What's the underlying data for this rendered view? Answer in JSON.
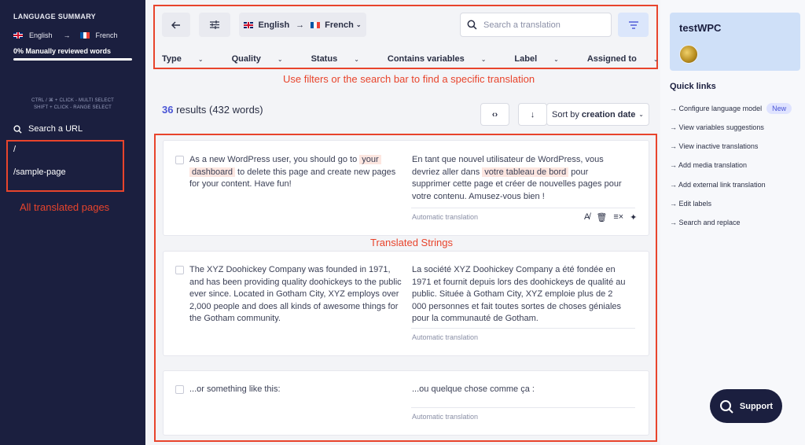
{
  "sidebar": {
    "summary_title": "LANGUAGE SUMMARY",
    "source_lang": "English",
    "target_lang": "French",
    "reviewed_text": "0% Manually reviewed words",
    "reviewed_percent": 0,
    "hint_line1": "CTRL / ⌘ + CLICK - MULTI SELECT",
    "hint_line2": "SHIFT + CLICK - RANGE SELECT",
    "search_url": "Search a URL",
    "pages": [
      "/",
      "/sample-page"
    ],
    "annotation": "All translated pages"
  },
  "toolbar": {
    "source_lang": "English",
    "target_lang": "French",
    "search_placeholder": "Search a translation",
    "filters": [
      "Type",
      "Quality",
      "Status",
      "Contains variables",
      "Label",
      "Assigned to"
    ],
    "annotation": "Use filters or the search bar to find a specific translation"
  },
  "results": {
    "count": "36",
    "text": "results (432 words)",
    "sort_prefix": "Sort by",
    "sort_value": "creation date"
  },
  "strings_annotation": "Translated Strings",
  "translations": [
    {
      "src_a": "As a new WordPress user, you should go to ",
      "src_hl1": "your",
      "src_hl2": "dashboard",
      "src_b": " to delete this page and create new pages for your content. Have fun!",
      "tgt_a": "En tant que nouvel utilisateur de WordPress, vous devriez aller dans ",
      "tgt_hl": "votre tableau de bord",
      "tgt_b": " pour supprimer cette page et créer de nouvelles pages pour votre contenu. Amusez-vous bien !",
      "status": "Automatic translation"
    },
    {
      "src": "The XYZ Doohickey Company was founded in 1971, and has been providing quality doohickeys to the public ever since. Located in Gotham City, XYZ employs over 2,000 people and does all kinds of awesome things for the Gotham community.",
      "tgt": "La société XYZ Doohickey Company a été fondée en 1971 et fournit depuis lors des doohickeys de qualité au public. Située à Gotham City, XYZ emploie plus de 2 000 personnes et fait toutes sortes de choses géniales pour la communauté de Gotham.",
      "status": "Automatic translation"
    },
    {
      "src": "...or something like this:",
      "tgt": "...ou quelque chose comme ça :",
      "status": "Automatic translation"
    }
  ],
  "right_panel": {
    "user_name": "testWPC",
    "quick_links_title": "Quick links",
    "links": [
      "Configure language model",
      "View variables suggestions",
      "View inactive translations",
      "Add media translation",
      "Add external link translation",
      "Edit labels",
      "Search and replace"
    ],
    "new_badge": "New",
    "support_label": "Support"
  },
  "colors": {
    "sidebar_bg": "#1b1f3f",
    "annotation_red": "#e8442c",
    "accent": "#4a55d6",
    "user_card": "#cfe0f8"
  }
}
